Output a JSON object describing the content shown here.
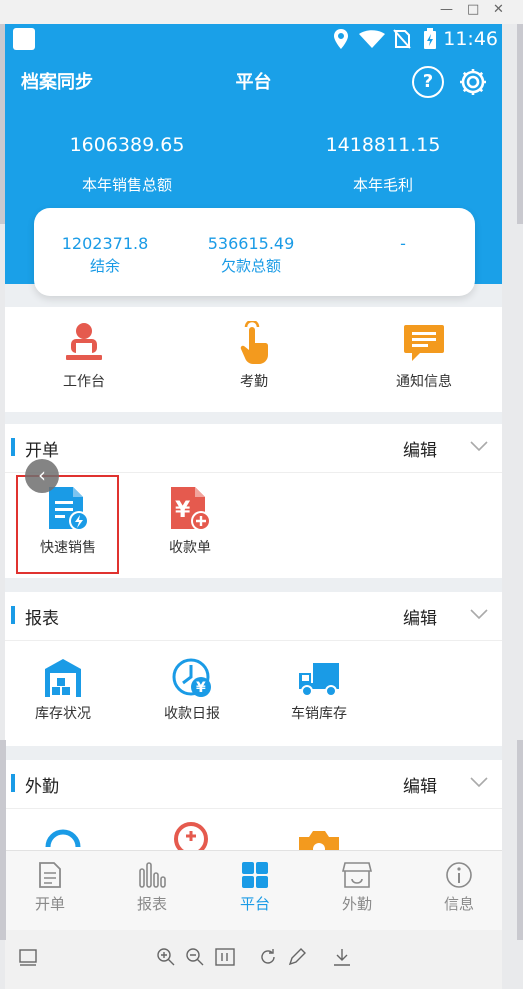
{
  "status_bar": {
    "time": "11:46"
  },
  "header": {
    "sync_label": "档案同步",
    "title": "平台",
    "help_label": "?",
    "stats": [
      {
        "value": "1606389.65",
        "label": "本年销售总额"
      },
      {
        "value": "1418811.15",
        "label": "本年毛利"
      }
    ],
    "card": [
      {
        "value": "1202371.8",
        "label": "结余"
      },
      {
        "value": "536615.49",
        "label": "欠款总额"
      },
      {
        "value": "-",
        "label": ""
      }
    ]
  },
  "quick": [
    {
      "label": "工作台",
      "icon": "workstation-icon"
    },
    {
      "label": "考勤",
      "icon": "tap-hand-icon"
    },
    {
      "label": "通知信息",
      "icon": "message-icon"
    }
  ],
  "sections": [
    {
      "title": "开单",
      "edit": "编辑",
      "items": [
        {
          "label": "快速销售",
          "icon": "quick-sale-icon"
        },
        {
          "label": "收款单",
          "icon": "receipt-icon"
        }
      ]
    },
    {
      "title": "报表",
      "edit": "编辑",
      "items": [
        {
          "label": "库存状况",
          "icon": "warehouse-icon"
        },
        {
          "label": "收款日报",
          "icon": "daily-receipt-icon"
        },
        {
          "label": "车销库存",
          "icon": "truck-icon"
        }
      ]
    },
    {
      "title": "外勤",
      "edit": "编辑"
    }
  ],
  "tabs": [
    {
      "label": "开单",
      "active": false
    },
    {
      "label": "报表",
      "active": false
    },
    {
      "label": "平台",
      "active": true
    },
    {
      "label": "外勤",
      "active": false
    },
    {
      "label": "信息",
      "active": false
    }
  ],
  "colors": {
    "primary": "#1aa0e8",
    "orange": "#f39a1e",
    "red": "#e55a4e",
    "blue": "#1a9be6",
    "highlight": "#e0322f"
  }
}
